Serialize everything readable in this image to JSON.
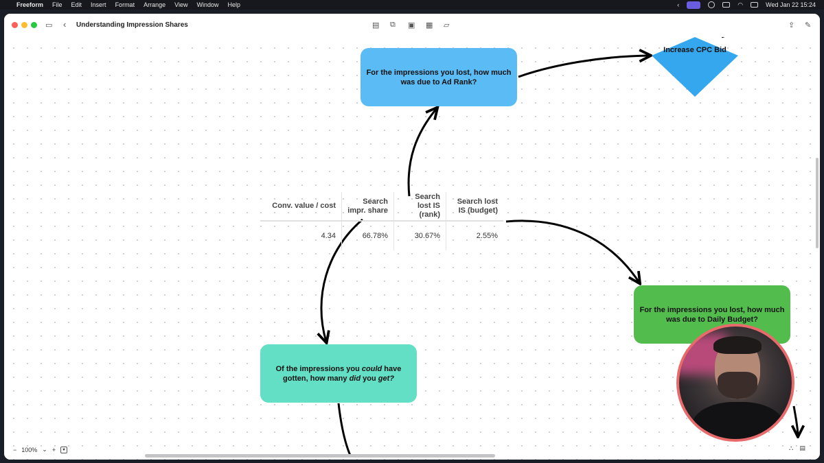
{
  "menubar": {
    "app": "Freeform",
    "items": [
      "File",
      "Edit",
      "Insert",
      "Format",
      "Arrange",
      "View",
      "Window",
      "Help"
    ],
    "clock": "Wed Jan 22  15:24"
  },
  "window": {
    "title": "Understanding Impression Shares"
  },
  "board": {
    "blue_box": "For the impressions you lost, how much was due to Ad Rank?",
    "diamond": "Increase CPC Bid",
    "green_box": "For the impressions you lost, how much was due to Daily Budget?",
    "teal_box": {
      "part1": "Of the impressions you ",
      "em1": "could",
      "part2": " have gotten, how many ",
      "em2": "did",
      "part3": " you ",
      "em3": "get?"
    },
    "table": {
      "headers": [
        "Conv. value / cost",
        "Search impr. share",
        "Search lost IS (rank)",
        "Search lost IS (budget)"
      ],
      "row": [
        "4.34",
        "66.78%",
        "30.67%",
        "2.55%"
      ]
    }
  },
  "bottombar": {
    "zoom_minus": "−",
    "zoom_level": "100%",
    "zoom_chevron": "⌄",
    "zoom_plus": "+"
  },
  "colors": {
    "blue_box": "#5bbbf5",
    "diamond": "#35a7ee",
    "green_box": "#52bd4d",
    "teal_box": "#62dfc5"
  }
}
